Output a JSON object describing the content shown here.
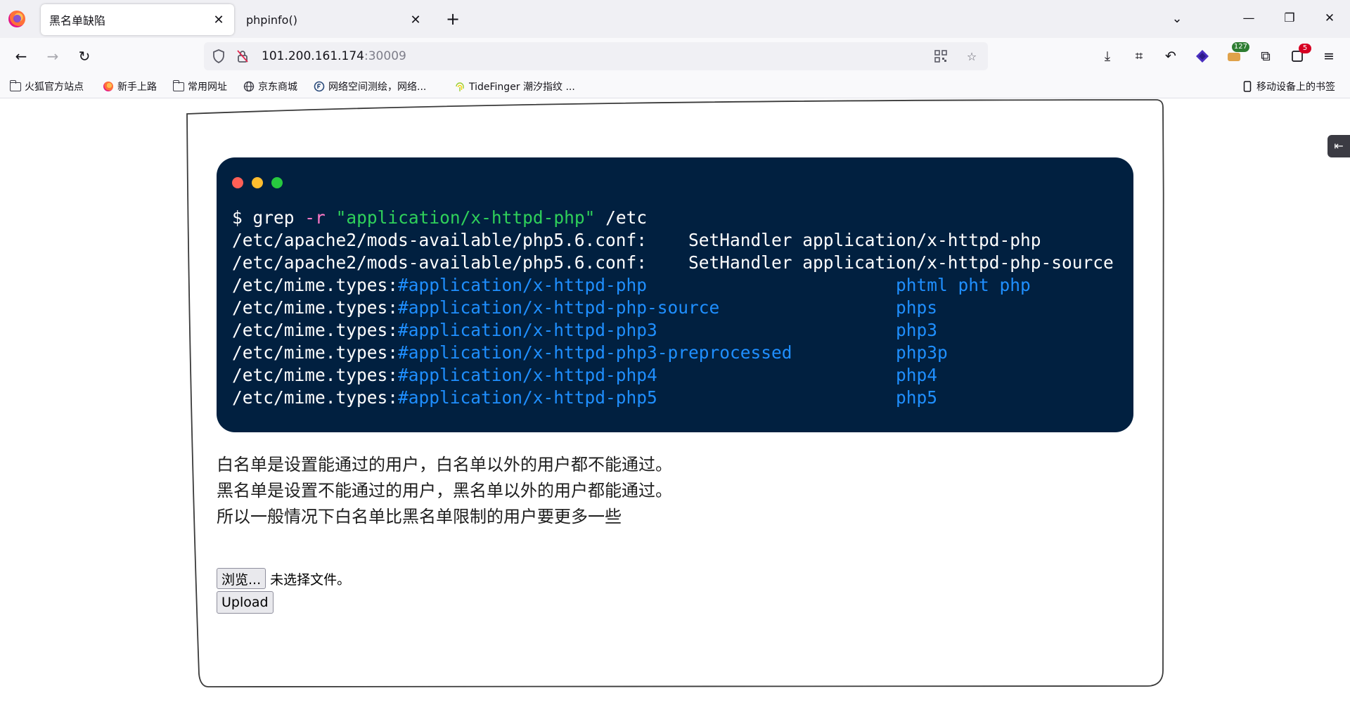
{
  "tabs": [
    {
      "label": "黑名单缺陷",
      "active": true
    },
    {
      "label": "phpinfo()",
      "active": false
    }
  ],
  "window": {
    "minimize": "—",
    "restore": "❐",
    "close": "✕",
    "tab_list": "⌄",
    "new_tab": "+"
  },
  "nav": {
    "url_host": "101.200.161.174",
    "url_port": ":30009",
    "badge_1": "127",
    "badge_2": "5"
  },
  "bookmarks": [
    {
      "label": "火狐官方站点",
      "icon": "folder-icon"
    },
    {
      "label": "新手上路",
      "icon": "firefox-icon"
    },
    {
      "label": "常用网址",
      "icon": "folder-icon"
    },
    {
      "label": "京东商城",
      "icon": "globe-icon"
    },
    {
      "label": "网络空间测绘，网络...",
      "icon": "fofa-icon"
    },
    {
      "label": "TideFinger 潮汐指纹 ...",
      "icon": "fingerprint-icon"
    }
  ],
  "mobile_bookmarks": "移动设备上的书签",
  "terminal": {
    "prompt": "$ ",
    "command": "grep",
    "flag": "-r",
    "arg": "\"application/x-httpd-php\"",
    "target": "/etc",
    "lines": [
      {
        "prefix": "/etc/apache2/mods-available/php5.6.conf:    SetHandler application/x-httpd-php",
        "comment": "",
        "ext": ""
      },
      {
        "prefix": "/etc/apache2/mods-available/php5.6.conf:    SetHandler application/x-httpd-php-source",
        "comment": "",
        "ext": ""
      },
      {
        "prefix": "/etc/mime.types:",
        "comment": "#application/x-httpd-php                        ",
        "ext": "phtml pht php"
      },
      {
        "prefix": "/etc/mime.types:",
        "comment": "#application/x-httpd-php-source                 ",
        "ext": "phps"
      },
      {
        "prefix": "/etc/mime.types:",
        "comment": "#application/x-httpd-php3                       ",
        "ext": "php3"
      },
      {
        "prefix": "/etc/mime.types:",
        "comment": "#application/x-httpd-php3-preprocessed          ",
        "ext": "php3p"
      },
      {
        "prefix": "/etc/mime.types:",
        "comment": "#application/x-httpd-php4                       ",
        "ext": "php4"
      },
      {
        "prefix": "/etc/mime.types:",
        "comment": "#application/x-httpd-php5                       ",
        "ext": "php5"
      }
    ]
  },
  "description": [
    "白名单是设置能通过的用户，白名单以外的用户都不能通过。",
    "黑名单是设置不能通过的用户，黑名单以外的用户都能通过。",
    "所以一般情况下白名单比黑名单限制的用户要更多一些"
  ],
  "form": {
    "browse_label": "浏览...",
    "no_file": "未选择文件。",
    "upload_label": "Upload"
  },
  "colors": {
    "terminal_bg": "#012040",
    "dot_red": "#ff5f56",
    "dot_yellow": "#ffbd2e",
    "dot_green": "#27c93f",
    "comment": "#1f8fff",
    "string": "#2fd05a",
    "flag": "#ff79c6"
  }
}
